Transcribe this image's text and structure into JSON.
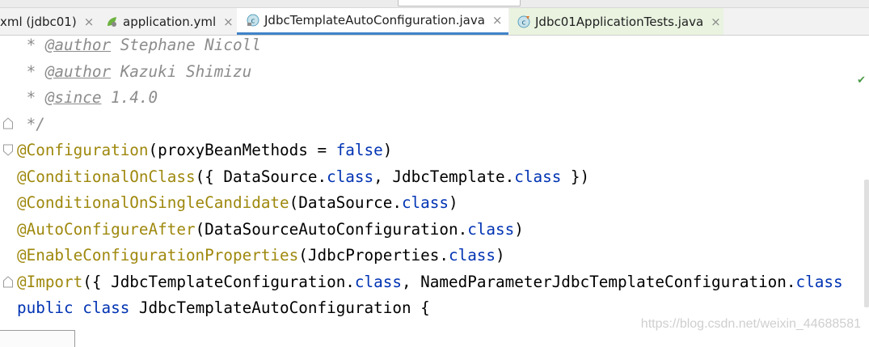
{
  "tabs": [
    {
      "label": "xml (jdbc01)",
      "icon": "xml-file-icon",
      "active": false
    },
    {
      "label": "application.yml",
      "icon": "spring-config-file-icon",
      "active": false
    },
    {
      "label": "JdbcTemplateAutoConfiguration.java",
      "icon": "java-class-icon",
      "active": true
    },
    {
      "label": "Jdbc01ApplicationTests.java",
      "icon": "java-test-class-icon",
      "active": false
    }
  ],
  "tab_close_glyph": "×",
  "code": {
    "author1_tag": "@author",
    "author1_name": " Stephane Nicoll",
    "author2_tag": "@author",
    "author2_name": " Kazuki Shimizu",
    "since_tag": "@since",
    "since_value": " 1.4.0",
    "comment_prefix": " * ",
    "comment_end": " */",
    "l5_ann": "@Configuration",
    "l5_a": "(proxyBeanMethods = ",
    "l5_kw": "false",
    "l5_b": ")",
    "l6_ann": "@ConditionalOnClass",
    "l6_a": "({ DataSource.",
    "l6_kw1": "class",
    "l6_b": ", JdbcTemplate.",
    "l6_kw2": "class",
    "l6_c": " })",
    "l7_ann": "@ConditionalOnSingleCandidate",
    "l7_a": "(DataSource.",
    "l7_kw": "class",
    "l7_b": ")",
    "l8_ann": "@AutoConfigureAfter",
    "l8_a": "(DataSourceAutoConfiguration.",
    "l8_kw": "class",
    "l8_b": ")",
    "l9_ann": "@EnableConfigurationProperties",
    "l9_a": "(JdbcProperties.",
    "l9_kw": "class",
    "l9_b": ")",
    "l10_ann": "@Import",
    "l10_a": "({ JdbcTemplateConfiguration.",
    "l10_kw1": "class",
    "l10_b": ", NamedParameterJdbcTemplateConfiguration.",
    "l10_kw2": "class",
    "l11_kw1": "public",
    "l11_sp": " ",
    "l11_kw2": "class",
    "l11_a": " JdbcTemplateAutoConfiguration {"
  },
  "watermark": "https://blog.csdn.net/weixin_44688581",
  "colors": {
    "annotation": "#9e880d",
    "keyword": "#0033b3",
    "comment": "#8c8c8c",
    "active_tab_underline": "#4083c9"
  }
}
